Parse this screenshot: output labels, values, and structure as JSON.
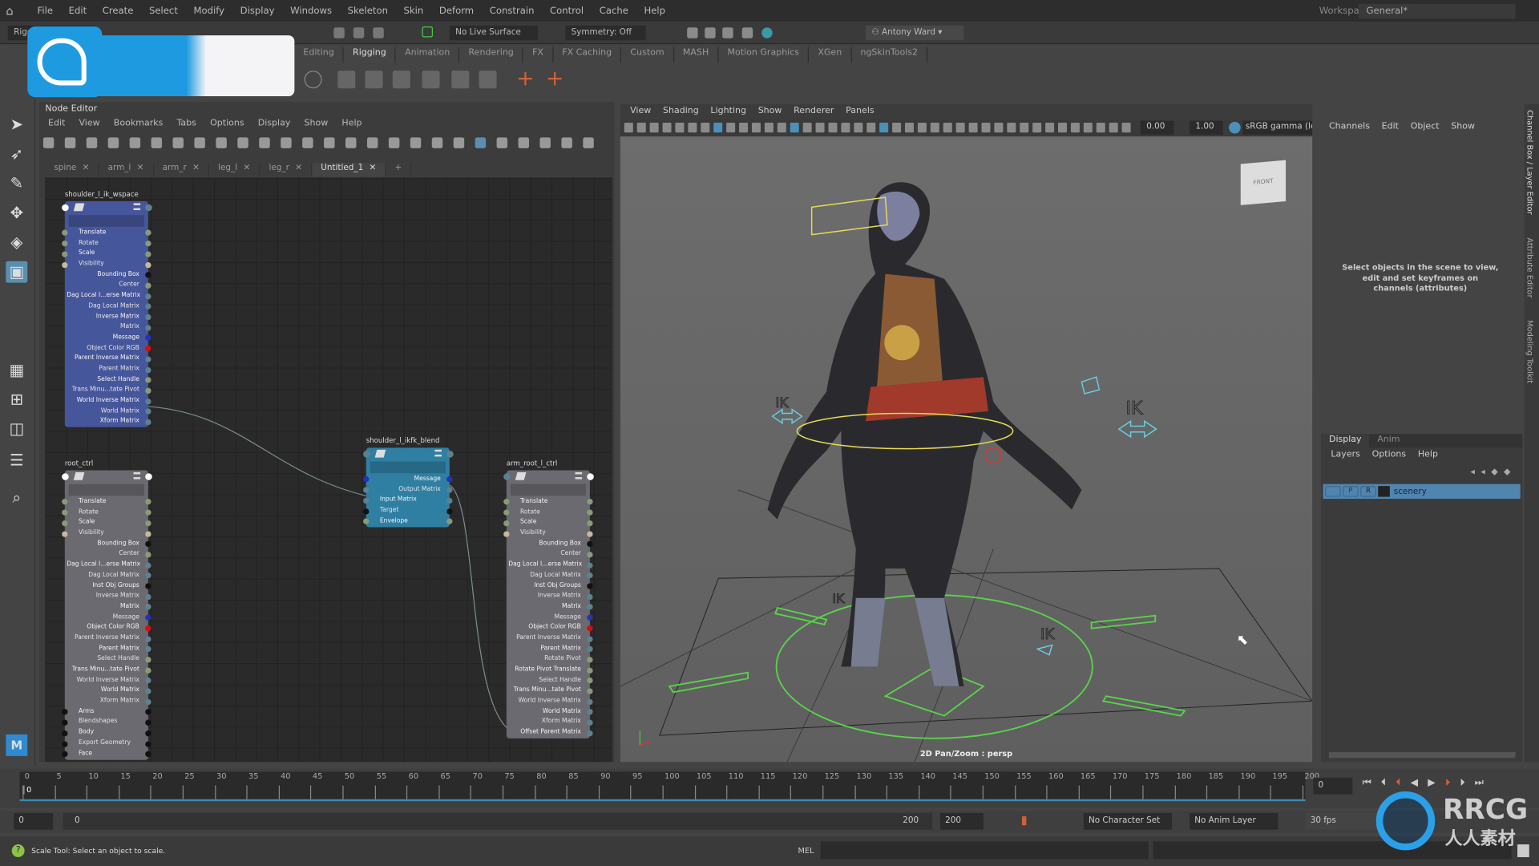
{
  "menubar": {
    "items": [
      "File",
      "Edit",
      "Create",
      "Select",
      "Modify",
      "Display",
      "Windows",
      "Skeleton",
      "Skin",
      "Deform",
      "Constrain",
      "Control",
      "Cache",
      "Help"
    ],
    "workspace_label": "Workspace:",
    "workspace_value": "General*"
  },
  "statusbar": {
    "menuset": "Rigging",
    "live_surface": "No Live Surface",
    "symmetry": "Symmetry: Off",
    "user": "Antony Ward"
  },
  "shelf": {
    "tabs": [
      "Editing",
      "Rigging",
      "Animation",
      "Rendering",
      "FX",
      "FX Caching",
      "Custom",
      "MASH",
      "Motion Graphics",
      "XGen",
      "ngSkinTools2"
    ],
    "active": "Rigging"
  },
  "node_editor": {
    "title": "Node Editor",
    "menu": [
      "Edit",
      "View",
      "Bookmarks",
      "Tabs",
      "Options",
      "Display",
      "Show",
      "Help"
    ],
    "tabs": [
      "spine",
      "arm_l",
      "arm_r",
      "leg_l",
      "leg_r",
      "Untitled_1"
    ],
    "active_tab": "Untitled_1",
    "add_tab": "+",
    "nodes": [
      {
        "name": "shoulder_l_ik_wspace",
        "color": "#46569a",
        "rows": [
          [
            "Translate",
            "l"
          ],
          [
            "Rotate",
            "l"
          ],
          [
            "Scale",
            "l"
          ],
          [
            "Visibility",
            "l"
          ],
          [
            "Bounding Box",
            "r"
          ],
          [
            "Center",
            "r"
          ],
          [
            "Dag Local I...erse Matrix",
            "r"
          ],
          [
            "Dag Local Matrix",
            "r"
          ],
          [
            "Inverse Matrix",
            "r"
          ],
          [
            "Matrix",
            "r"
          ],
          [
            "Message",
            "r"
          ],
          [
            "Object Color RGB",
            "r"
          ],
          [
            "Parent Inverse Matrix",
            "r"
          ],
          [
            "Parent Matrix",
            "r"
          ],
          [
            "Select Handle",
            "r"
          ],
          [
            "Trans Minu...tate Pivot",
            "r"
          ],
          [
            "World Inverse Matrix",
            "r"
          ],
          [
            "World Matrix",
            "r"
          ],
          [
            "Xform Matrix",
            "r"
          ]
        ]
      },
      {
        "name": "root_ctrl",
        "color": "#6a6a70",
        "rows": [
          [
            "Translate",
            "l"
          ],
          [
            "Rotate",
            "l"
          ],
          [
            "Scale",
            "l"
          ],
          [
            "Visibility",
            "l"
          ],
          [
            "Bounding Box",
            "r"
          ],
          [
            "Center",
            "r"
          ],
          [
            "Dag Local I...erse Matrix",
            "r"
          ],
          [
            "Dag Local Matrix",
            "r"
          ],
          [
            "Inst Obj Groups",
            "r"
          ],
          [
            "Inverse Matrix",
            "r"
          ],
          [
            "Matrix",
            "r"
          ],
          [
            "Message",
            "r"
          ],
          [
            "Object Color RGB",
            "r"
          ],
          [
            "Parent Inverse Matrix",
            "r"
          ],
          [
            "Parent Matrix",
            "r"
          ],
          [
            "Select Handle",
            "r"
          ],
          [
            "Trans Minu...tate Pivot",
            "r"
          ],
          [
            "World Inverse Matrix",
            "r"
          ],
          [
            "World Matrix",
            "r"
          ],
          [
            "Xform Matrix",
            "r"
          ],
          [
            "Arms",
            "l"
          ],
          [
            "Blendshapes",
            "l"
          ],
          [
            "Body",
            "l"
          ],
          [
            "Export Geometry",
            "l"
          ],
          [
            "Face",
            "l"
          ]
        ]
      },
      {
        "name": "shoulder_l_ikfk_blend",
        "color": "#2f7fa3",
        "rows": [
          [
            "Message",
            "r"
          ],
          [
            "Output Matrix",
            "r"
          ],
          [
            "Input Matrix",
            "l"
          ],
          [
            "Target",
            "l"
          ],
          [
            "Envelope",
            "l"
          ]
        ]
      },
      {
        "name": "arm_root_l_ctrl",
        "color": "#6a6a70",
        "rows": [
          [
            "Translate",
            "l"
          ],
          [
            "Rotate",
            "l"
          ],
          [
            "Scale",
            "l"
          ],
          [
            "Visibility",
            "l"
          ],
          [
            "Bounding Box",
            "r"
          ],
          [
            "Center",
            "r"
          ],
          [
            "Dag Local I...erse Matrix",
            "r"
          ],
          [
            "Dag Local Matrix",
            "r"
          ],
          [
            "Inst Obj Groups",
            "r"
          ],
          [
            "Inverse Matrix",
            "r"
          ],
          [
            "Matrix",
            "r"
          ],
          [
            "Message",
            "r"
          ],
          [
            "Object Color RGB",
            "r"
          ],
          [
            "Parent Inverse Matrix",
            "r"
          ],
          [
            "Parent Matrix",
            "r"
          ],
          [
            "Rotate Pivot",
            "r"
          ],
          [
            "Rotate Pivot Translate",
            "r"
          ],
          [
            "Select Handle",
            "r"
          ],
          [
            "Trans Minu...tate Pivot",
            "r"
          ],
          [
            "World Inverse Matrix",
            "r"
          ],
          [
            "World Matrix",
            "r"
          ],
          [
            "Xform Matrix",
            "r"
          ],
          [
            "Offset Parent Matrix",
            "r"
          ]
        ]
      }
    ]
  },
  "viewport": {
    "menu": [
      "View",
      "Shading",
      "Lighting",
      "Show",
      "Renderer",
      "Panels"
    ],
    "exposure": "0.00",
    "gamma": "1.00",
    "colorspace": "sRGB gamma (leg",
    "camera_label": "2D Pan/Zoom : persp",
    "viewcube": "FRONT",
    "ik_labels": [
      "IK",
      "IK",
      "IK",
      "IK"
    ]
  },
  "channel_box": {
    "menu": [
      "Channels",
      "Edit",
      "Object",
      "Show"
    ],
    "empty_message": "Select objects in the scene to view, edit and set keyframes on channels (attributes)",
    "layer_tabs": [
      "Display",
      "Anim"
    ],
    "layer_menu": [
      "Layers",
      "Options",
      "Help"
    ],
    "layer": {
      "v": "",
      "p": "P",
      "r": "R",
      "name": "scenery"
    },
    "side_tabs": [
      "Channel Box / Layer Editor",
      "Attribute Editor",
      "Modeling Toolkit"
    ]
  },
  "timeline": {
    "ticks": [
      "0",
      "5",
      "10",
      "15",
      "20",
      "25",
      "30",
      "35",
      "40",
      "45",
      "50",
      "55",
      "60",
      "65",
      "70",
      "75",
      "80",
      "85",
      "90",
      "95",
      "100",
      "105",
      "110",
      "115",
      "120",
      "125",
      "130",
      "135",
      "140",
      "145",
      "150",
      "155",
      "160",
      "165",
      "170",
      "175",
      "180",
      "185",
      "190",
      "195",
      "200"
    ],
    "current_frame": "0",
    "current_field": "0"
  },
  "range": {
    "start": "0",
    "inner_start": "0",
    "inner_end": "200",
    "end": "200",
    "character_set": "No Character Set",
    "anim_layer": "No Anim Layer",
    "fps": "30 fps"
  },
  "commandline": {
    "status": "Scale Tool: Select an object to scale.",
    "lang": "MEL"
  },
  "watermark": {
    "text": "RRCG",
    "subtext": "人人素材"
  },
  "colors": {
    "accent": "#4a90b8",
    "node_blue": "#46569a",
    "node_teal": "#2f7fa3",
    "control_green": "#59d44a"
  }
}
